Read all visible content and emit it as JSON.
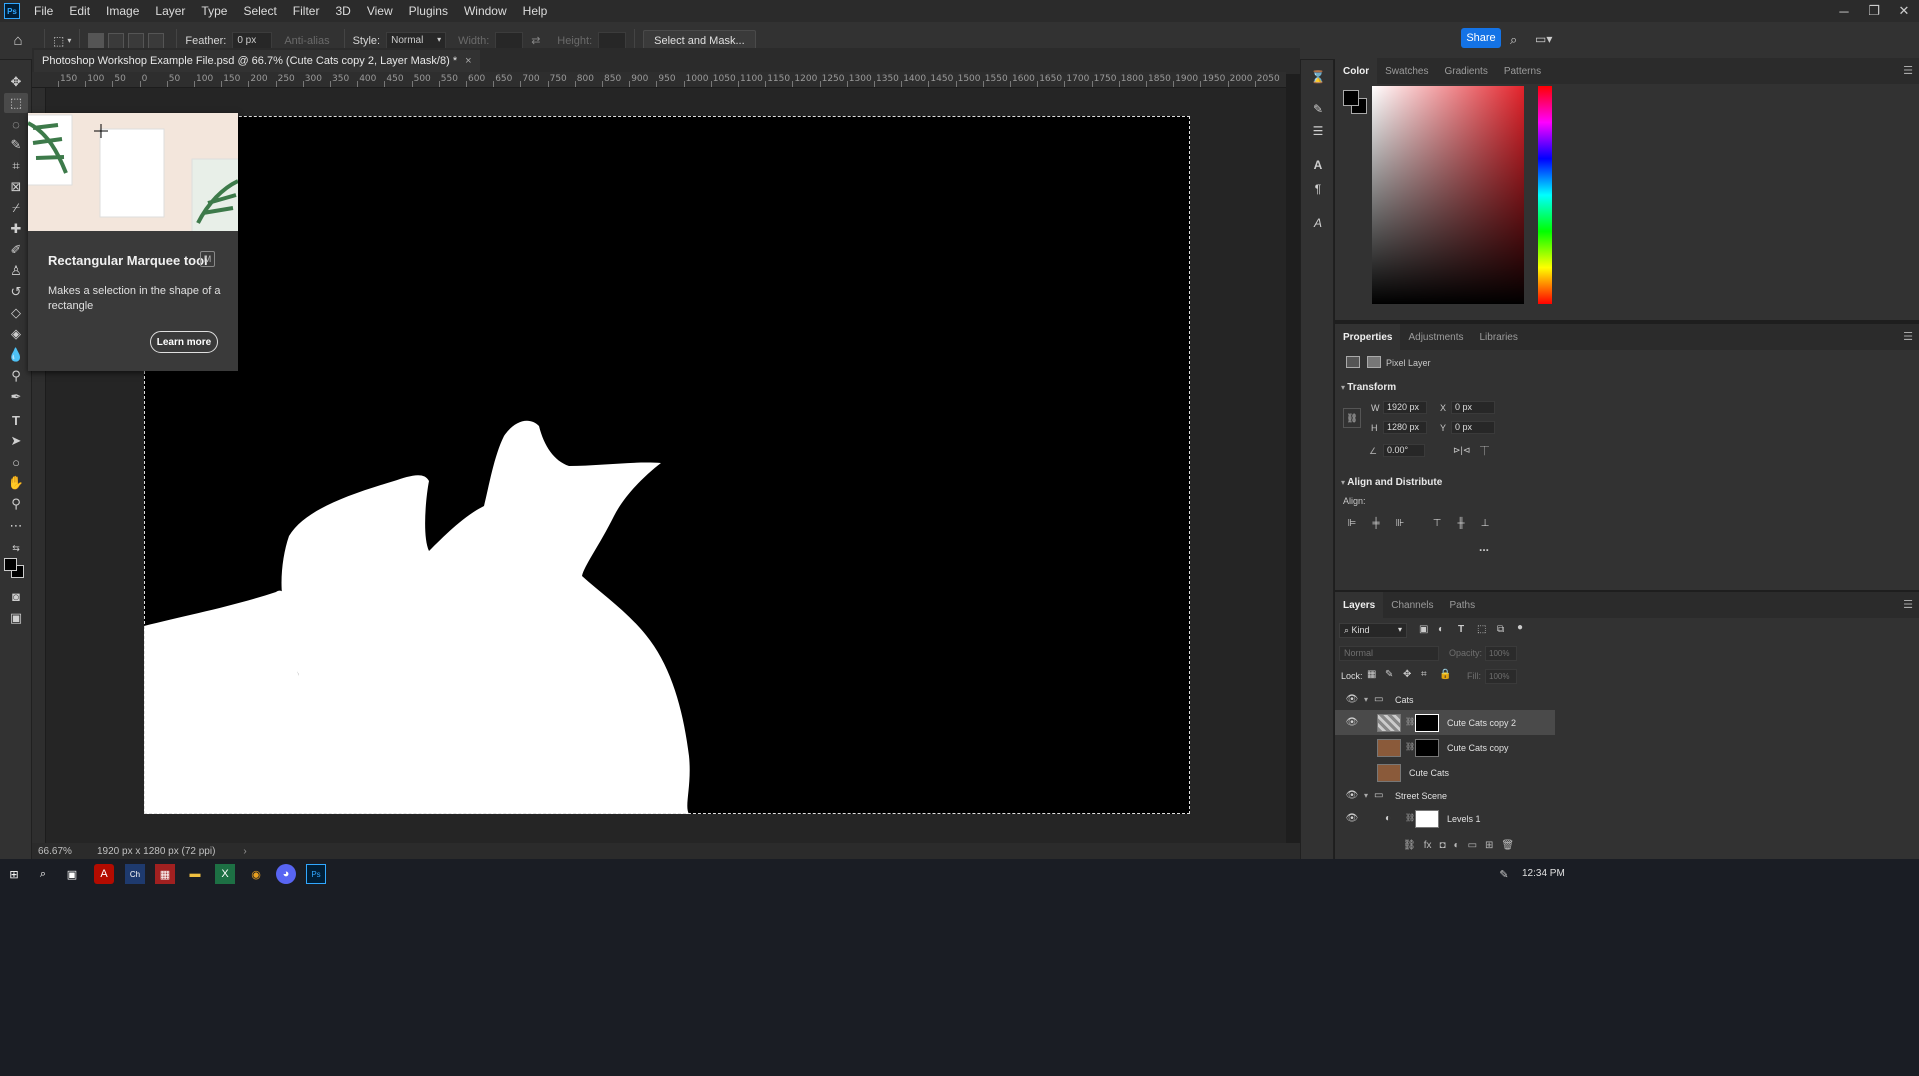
{
  "menu": {
    "logo": "Ps",
    "items": [
      "File",
      "Edit",
      "Image",
      "Layer",
      "Type",
      "Select",
      "Filter",
      "3D",
      "View",
      "Plugins",
      "Window",
      "Help"
    ]
  },
  "options": {
    "feather_label": "Feather:",
    "feather_value": "0 px",
    "antialias_label": "Anti-alias",
    "style_label": "Style:",
    "style_value": "Normal",
    "width_label": "Width:",
    "height_label": "Height:",
    "select_mask": "Select and Mask...",
    "share": "Share"
  },
  "document": {
    "tab_title": "Photoshop Workshop Example File.psd @ 66.7% (Cute Cats copy 2, Layer Mask/8) *",
    "close": "×"
  },
  "ruler": {
    "h_ticks": [
      "150",
      "100",
      "50",
      "0",
      "50",
      "100",
      "150",
      "200",
      "250",
      "300",
      "350",
      "400",
      "450",
      "500",
      "550",
      "600",
      "650",
      "700",
      "750",
      "800",
      "850",
      "900",
      "950",
      "1000",
      "1050",
      "1100",
      "1150",
      "1200",
      "1250",
      "1300",
      "1350",
      "1400",
      "1450",
      "1500",
      "1550",
      "1600",
      "1650",
      "1700",
      "1750",
      "1800",
      "1850",
      "1900",
      "1950",
      "2000",
      "2050"
    ]
  },
  "status": {
    "zoom": "66.67%",
    "doc_info": "1920 px x 1280 px (72 ppi)",
    "arrow": "›"
  },
  "tooltip": {
    "title": "Rectangular Marquee tool",
    "key": "M",
    "description": "Makes a selection in the shape of a rectangle",
    "learn_more": "Learn more"
  },
  "color_panel": {
    "tabs": [
      "Color",
      "Swatches",
      "Gradients",
      "Patterns"
    ],
    "fg_color": "#000000",
    "bg_color": "#000000"
  },
  "properties": {
    "tabs": [
      "Properties",
      "Adjustments",
      "Libraries"
    ],
    "layer_type": "Pixel Layer",
    "transform_title": "Transform",
    "w_label": "W",
    "w_value": "1920 px",
    "h_label": "H",
    "h_value": "1280 px",
    "x_label": "X",
    "x_value": "0 px",
    "y_label": "Y",
    "y_value": "0 px",
    "angle_value": "0.00°",
    "align_title": "Align and Distribute",
    "align_label": "Align:",
    "more": "..."
  },
  "layers": {
    "tabs": [
      "Layers",
      "Channels",
      "Paths"
    ],
    "kind_label": "Kind",
    "blend_mode": "Normal",
    "opacity_label": "Opacity:",
    "opacity_value": "100%",
    "lock_label": "Lock:",
    "fill_label": "Fill:",
    "fill_value": "100%",
    "rows": [
      {
        "name": "Cats",
        "type": "group"
      },
      {
        "name": "Cute Cats copy 2",
        "type": "masked",
        "selected": true
      },
      {
        "name": "Cute Cats copy",
        "type": "masked"
      },
      {
        "name": "Cute Cats",
        "type": "pixel"
      },
      {
        "name": "Street Scene",
        "type": "group"
      },
      {
        "name": "Levels 1",
        "type": "adjustment"
      }
    ]
  },
  "taskbar": {
    "time": "12:34 PM"
  }
}
